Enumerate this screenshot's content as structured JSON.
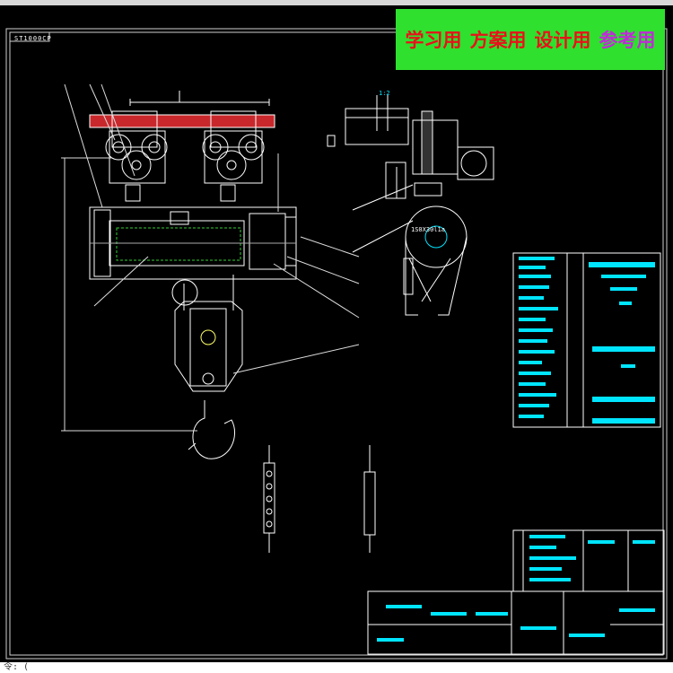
{
  "banner": {
    "items": [
      {
        "label": "学习用",
        "color": "#e8121a"
      },
      {
        "label": "方案用",
        "color": "#e8121a"
      },
      {
        "label": "设计用",
        "color": "#e8121a"
      },
      {
        "label": "参考用",
        "color": "#c02ad8"
      }
    ]
  },
  "drawing": {
    "title": "ST1000CP",
    "scale_text": "1:2",
    "drum_label": "1S0X30l1a"
  },
  "status_bar": {
    "prompt": "令: ("
  },
  "colors": {
    "background": "#000000",
    "lines": "#ffffff",
    "accent_cyan": "#00e5ff",
    "rail_red": "#c8282c",
    "hatch_green": "#33cc33",
    "banner_green": "#2fe02f"
  }
}
